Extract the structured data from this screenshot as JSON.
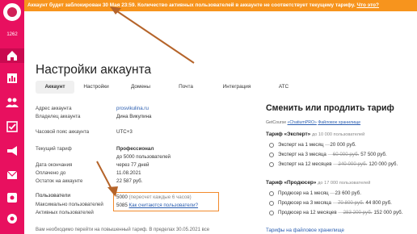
{
  "banner": {
    "text": "Аккаунт будет заблокирован 30 Мая 23:59. Количество активных пользователей в аккаунте не соответствует текущему тарифу.",
    "link": "Что это?"
  },
  "sidebar": {
    "count": "1262",
    "icons": [
      "home-icon",
      "stats-icon",
      "users-icon",
      "tasks-icon",
      "megaphone-icon",
      "mail-icon",
      "settings-icon",
      "support-icon"
    ]
  },
  "page": {
    "title": "Настройки аккаунта"
  },
  "tabs": [
    "Аккаунт",
    "Настройки",
    "Домены",
    "Почта",
    "Интеграция",
    "АТС"
  ],
  "account": {
    "address_label": "Адрес аккаунта",
    "address_value": "prosvikulina.ru",
    "owner_label": "Владелец аккаунта",
    "owner_value": "Дина Викулина",
    "timezone_label": "Часовой пояс аккаунта",
    "timezone_value": "UTC+3",
    "tariff_label": "Текущий тариф",
    "tariff_value": "Профессионал",
    "tariff_limit": "до 5000 пользователей",
    "end_label": "Дата окончания",
    "end_value": "через 77 дней",
    "paid_label": "Оплачено до",
    "paid_value": "11.08.2021",
    "balance_label": "Остаток на аккаунте",
    "balance_value": "22 587 руб."
  },
  "users": {
    "heading": "Пользователи",
    "max_label": "Максимально пользователей",
    "max_value": "5000",
    "max_note": "(пересчет каждые 6 часов)",
    "active_label": "Активных пользователей",
    "active_value": "5085",
    "active_link": "Как считаются пользователи?"
  },
  "bottom_note": "Вам необходимо перейти на повышенный тариф. В пределах 30.05.2021 все",
  "right": {
    "title": "Сменить или продлить тариф",
    "sub_prefix": "GetCourse",
    "sub_link1": "«ChatiumPRO»",
    "sub_link2": "Файловое хранилище",
    "expert_head": "Тариф «Эксперт»",
    "expert_sub": "до 10 000 пользователей",
    "expert_opts": [
      {
        "label": "Эксперт на 1 месяц",
        "old": "",
        "price": "20 000 руб."
      },
      {
        "label": "Эксперт на 3 месяца",
        "old": "60 000 руб.",
        "price": "57 500 руб."
      },
      {
        "label": "Эксперт на 12 месяцев",
        "old": "240 000 руб.",
        "price": "120 000 руб."
      }
    ],
    "prodiser_head": "Тариф «Продюсер»",
    "prodiser_sub": "до 17 000 пользователей",
    "prodiser_opts": [
      {
        "label": "Продюсер на 1 месяц",
        "old": "",
        "price": "23 600 руб."
      },
      {
        "label": "Продюсер на 3 месяца",
        "old": "70 800 руб.",
        "price": "44 800 руб."
      },
      {
        "label": "Продюсер на 12 месяцев",
        "old": "283 200 руб.",
        "price": "152 000 руб."
      }
    ],
    "storage_link": "Тарифы на файловое хранилище"
  },
  "colors": {
    "banner": "#f7941d",
    "sidebar": "#e8105f",
    "link": "#2a5db0",
    "highlight": "#f28a2c",
    "arrow": "#b5642a"
  }
}
